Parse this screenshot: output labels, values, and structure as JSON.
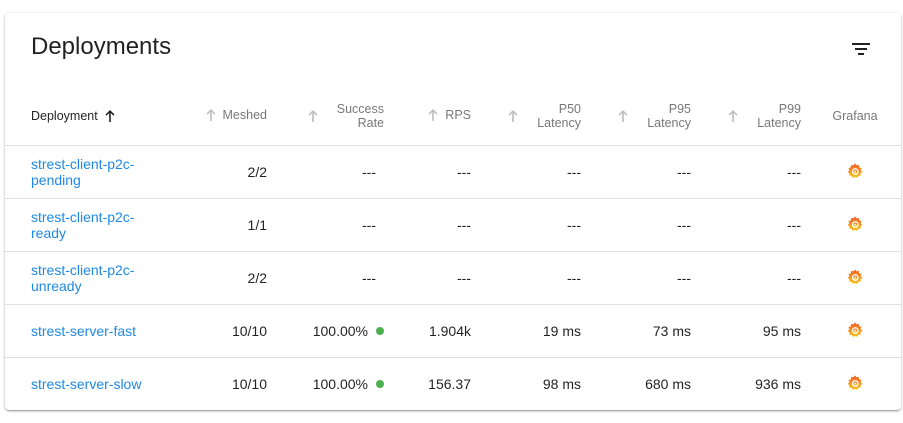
{
  "card": {
    "title": "Deployments"
  },
  "table": {
    "headers": {
      "deployment": "Deployment",
      "meshed": "Meshed",
      "success_rate_1": "Success",
      "success_rate_2": "Rate",
      "rps": "RPS",
      "p50_1": "P50",
      "p50_2": "Latency",
      "p95_1": "P95",
      "p95_2": "Latency",
      "p99_1": "P99",
      "p99_2": "Latency",
      "grafana": "Grafana"
    },
    "rows": [
      {
        "name": "strest-client-p2c-pending",
        "meshed": "2/2",
        "success_rate": "---",
        "rps": "---",
        "p50": "---",
        "p95": "---",
        "p99": "---"
      },
      {
        "name": "strest-client-p2c-ready",
        "meshed": "1/1",
        "success_rate": "---",
        "rps": "---",
        "p50": "---",
        "p95": "---",
        "p99": "---"
      },
      {
        "name": "strest-client-p2c-unready",
        "meshed": "2/2",
        "success_rate": "---",
        "rps": "---",
        "p50": "---",
        "p95": "---",
        "p99": "---"
      },
      {
        "name": "strest-server-fast",
        "meshed": "10/10",
        "success_rate": "100.00%",
        "rps": "1.904k",
        "p50": "19 ms",
        "p95": "73 ms",
        "p99": "95 ms"
      },
      {
        "name": "strest-server-slow",
        "meshed": "10/10",
        "success_rate": "100.00%",
        "rps": "156.37",
        "p50": "98 ms",
        "p95": "680 ms",
        "p99": "936 ms"
      }
    ]
  },
  "icons": {
    "filter": "filter-list-icon",
    "sort_active": "arrow-upward-icon",
    "sort_inactive": "arrow-upward-icon",
    "grafana": "grafana-icon",
    "status": "green-dot"
  },
  "colors": {
    "link": "#1e88e5",
    "status_ok": "#4caf50",
    "grafana_orange": "#f46800"
  }
}
